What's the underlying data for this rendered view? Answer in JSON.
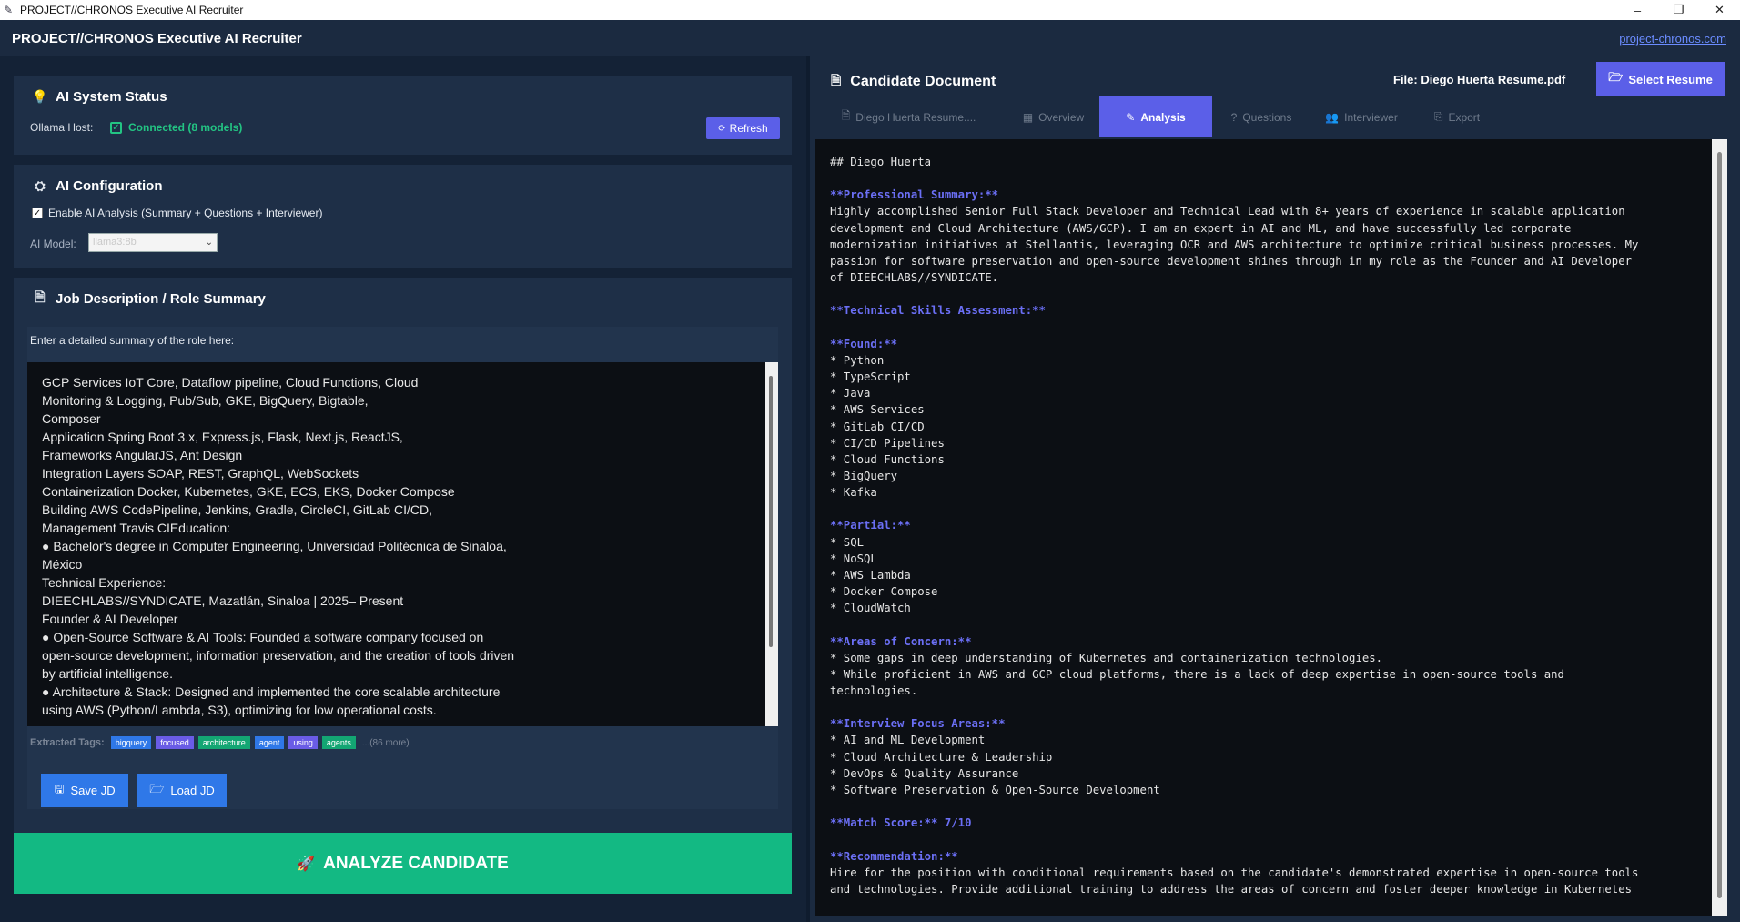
{
  "window": {
    "title": "PROJECT//CHRONOS Executive AI Recruiter",
    "controls": {
      "minimize": "–",
      "maximize": "❐",
      "close": "✕"
    }
  },
  "header": {
    "title": "PROJECT//CHRONOS Executive AI Recruiter",
    "link": "project-chronos.com"
  },
  "status": {
    "title": "AI System Status",
    "host_label": "Ollama Host:",
    "host_value": "Connected (8 models)",
    "refresh_label": "Refresh"
  },
  "config": {
    "title": "AI Configuration",
    "enable_label": "Enable AI Analysis (Summary + Questions + Interviewer)",
    "enable_checked": true,
    "model_label": "AI Model:",
    "model_value": "llama3:8b"
  },
  "jd": {
    "title": "Job Description / Role Summary",
    "prompt": "Enter a detailed summary of the role here:",
    "text": "GCP Services IoT Core, Dataflow pipeline, Cloud Functions, Cloud\nMonitoring & Logging, Pub/Sub, GKE, BigQuery, Bigtable,\nComposer\nApplication Spring Boot 3.x, Express.js, Flask, Next.js, ReactJS,\nFrameworks AngularJS, Ant Design\nIntegration Layers SOAP, REST, GraphQL, WebSockets\nContainerization Docker, Kubernetes, GKE, ECS, EKS, Docker Compose\nBuilding AWS CodePipeline, Jenkins, Gradle, CircleCI, GitLab CI/CD,\nManagement Travis CIEducation:\n● Bachelor's degree in Computer Engineering, Universidad Politécnica de Sinaloa,\nMéxico\nTechnical Experience:\nDIEECHLABS//SYNDICATE, Mazatlán, Sinaloa | 2025– Present\nFounder & AI Developer\n● Open-Source Software & AI Tools: Founded a software company focused on\nopen-source development, information preservation, and the creation of tools driven\nby artificial intelligence.\n● Architecture & Stack: Designed and implemented the core scalable architecture\nusing AWS (Python/Lambda, S3), optimizing for low operational costs.",
    "tags_label": "Extracted Tags:",
    "tags": [
      {
        "label": "bigquery",
        "color": "#2f78e8"
      },
      {
        "label": "focused",
        "color": "#6a5ce6"
      },
      {
        "label": "architecture",
        "color": "#13a673"
      },
      {
        "label": "agent",
        "color": "#2f78e8"
      },
      {
        "label": "using",
        "color": "#6a5ce6"
      },
      {
        "label": "agents",
        "color": "#13a673"
      }
    ],
    "tags_more": "...(86 more)",
    "save_label": "Save JD",
    "load_label": "Load JD"
  },
  "analyze_label": "ANALYZE CANDIDATE",
  "document": {
    "title": "Candidate Document",
    "file_label": "File: Diego Huerta Resume.pdf",
    "select_label": "Select Resume",
    "tabs": [
      {
        "label": "Diego Huerta Resume....",
        "icon": "document-icon"
      },
      {
        "label": "Overview",
        "icon": "chart-icon"
      },
      {
        "label": "Analysis",
        "icon": "edit-icon"
      },
      {
        "label": "Questions",
        "icon": "question-icon"
      },
      {
        "label": "Interviewer",
        "icon": "people-icon"
      },
      {
        "label": "Export",
        "icon": "export-icon"
      }
    ],
    "active_tab": "Analysis",
    "lines": [
      {
        "text": "## Diego Huerta",
        "hl": false
      },
      {
        "text": "",
        "hl": false
      },
      {
        "text": "**Professional Summary:**",
        "hl": true
      },
      {
        "text": "Highly accomplished Senior Full Stack Developer and Technical Lead with 8+ years of experience in scalable application",
        "hl": false
      },
      {
        "text": "development and Cloud Architecture (AWS/GCP). I am an expert in AI and ML, and have successfully led corporate",
        "hl": false
      },
      {
        "text": "modernization initiatives at Stellantis, leveraging OCR and AWS architecture to optimize critical business processes. My",
        "hl": false
      },
      {
        "text": "passion for software preservation and open-source development shines through in my role as the Founder and AI Developer",
        "hl": false
      },
      {
        "text": "of DIEECHLABS//SYNDICATE.",
        "hl": false
      },
      {
        "text": "",
        "hl": false
      },
      {
        "text": "**Technical Skills Assessment:**",
        "hl": true
      },
      {
        "text": "",
        "hl": false
      },
      {
        "text": "**Found:**",
        "hl": true
      },
      {
        "text": "* Python",
        "hl": false
      },
      {
        "text": "* TypeScript",
        "hl": false
      },
      {
        "text": "* Java",
        "hl": false
      },
      {
        "text": "* AWS Services",
        "hl": false
      },
      {
        "text": "* GitLab CI/CD",
        "hl": false
      },
      {
        "text": "* CI/CD Pipelines",
        "hl": false
      },
      {
        "text": "* Cloud Functions",
        "hl": false
      },
      {
        "text": "* BigQuery",
        "hl": false
      },
      {
        "text": "* Kafka",
        "hl": false
      },
      {
        "text": "",
        "hl": false
      },
      {
        "text": "**Partial:**",
        "hl": true
      },
      {
        "text": "* SQL",
        "hl": false
      },
      {
        "text": "* NoSQL",
        "hl": false
      },
      {
        "text": "* AWS Lambda",
        "hl": false
      },
      {
        "text": "* Docker Compose",
        "hl": false
      },
      {
        "text": "* CloudWatch",
        "hl": false
      },
      {
        "text": "",
        "hl": false
      },
      {
        "text": "**Areas of Concern:**",
        "hl": true
      },
      {
        "text": "* Some gaps in deep understanding of Kubernetes and containerization technologies.",
        "hl": false
      },
      {
        "text": "* While proficient in AWS and GCP cloud platforms, there is a lack of deep expertise in open-source tools and",
        "hl": false
      },
      {
        "text": "technologies.",
        "hl": false
      },
      {
        "text": "",
        "hl": false
      },
      {
        "text": "**Interview Focus Areas:**",
        "hl": true
      },
      {
        "text": "* AI and ML Development",
        "hl": false
      },
      {
        "text": "* Cloud Architecture & Leadership",
        "hl": false
      },
      {
        "text": "* DevOps & Quality Assurance",
        "hl": false
      },
      {
        "text": "* Software Preservation & Open-Source Development",
        "hl": false
      },
      {
        "text": "",
        "hl": false
      },
      {
        "text": "**Match Score:** 7/10",
        "hl": true
      },
      {
        "text": "",
        "hl": false
      },
      {
        "text": "**Recommendation:**",
        "hl": true
      },
      {
        "text": "Hire for the position with conditional requirements based on the candidate's demonstrated expertise in open-source tools",
        "hl": false
      },
      {
        "text": "and technologies. Provide additional training to address the areas of concern and foster deeper knowledge in Kubernetes",
        "hl": false
      }
    ]
  }
}
